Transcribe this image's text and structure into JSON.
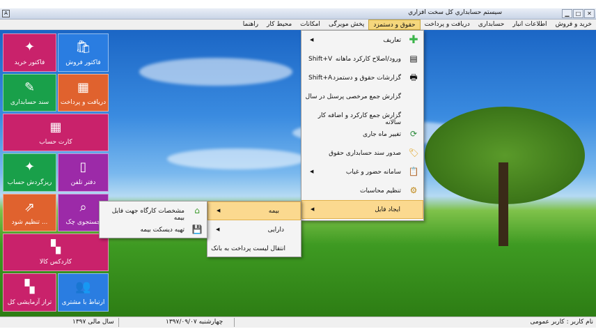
{
  "window": {
    "title": "سيستم حسابداري کل سخت افزاري",
    "icon": "app-icon"
  },
  "menubar": [
    "خرید و فروش",
    "اطلاعات انبار",
    "حسابداری",
    "دریافت و پرداخت",
    "حقوق و دستمزد",
    "پخش مویرگی",
    "امکانات",
    "محیط کار",
    "راهنما"
  ],
  "tiles": [
    {
      "label": "فاکتور فروش",
      "icon": "shopping-bag-icon",
      "color": "#2a7de1"
    },
    {
      "label": "فاکتور خرید",
      "icon": "puzzle-icon",
      "color": "#c9226b"
    },
    {
      "label": "دریافت و پرداخت",
      "icon": "calculator-icon",
      "color": "#e0622e"
    },
    {
      "label": "سند حسابداری",
      "icon": "document-edit-icon",
      "color": "#19a04a"
    },
    {
      "label": "کارت حساب",
      "icon": "grid-table-icon",
      "color": "#c9226b"
    },
    {
      "label": "دفتر تلفن",
      "icon": "phone-icon",
      "color": "#9c2aa8"
    },
    {
      "label": "ریزگردش حساب",
      "icon": "puzzle-icon",
      "color": "#19a04a"
    },
    {
      "label": "جستجوی چک",
      "icon": "search-document-icon",
      "color": "#9c2aa8"
    },
    {
      "label": "تنظیم شود ...",
      "icon": "external-link-icon",
      "color": "#e0622e"
    },
    {
      "label": "کاردکس کالا",
      "icon": "tiles-icon",
      "color": "#c9226b"
    },
    {
      "label": "ارتباط با مشتری",
      "icon": "users-icon",
      "color": "#2a7de1"
    },
    {
      "label": "تراز آزمایشی کل",
      "icon": "tiles-icon",
      "color": "#c9226b"
    }
  ],
  "main_menu": [
    {
      "label": "تعاریف",
      "icon": "plus-icon",
      "shortcut": "",
      "submenu": true
    },
    {
      "label": "ورود/اصلاح کارکرد ماهانه",
      "icon": "form-icon",
      "shortcut": "Shift+V",
      "submenu": false
    },
    {
      "label": "گزارشات حقوق و دستمزد",
      "icon": "printer-icon",
      "shortcut": "Shift+A",
      "submenu": false
    },
    {
      "label": "گزارش جمع مرخصی پرسنل در سال",
      "icon": "",
      "shortcut": "",
      "submenu": false
    },
    {
      "label": "گزارش جمع کارکرد و اضافه کار سالانه",
      "icon": "",
      "shortcut": "",
      "submenu": false
    },
    {
      "label": "تغییر ماه جاری",
      "icon": "refresh-icon",
      "shortcut": "",
      "submenu": false
    },
    {
      "label": "صدور سند حسابداری حقوق",
      "icon": "tag-icon",
      "shortcut": "",
      "submenu": false
    },
    {
      "label": "سامانه حضور و غیاب",
      "icon": "clipboard-icon",
      "shortcut": "",
      "submenu": true
    },
    {
      "label": "تنظیم محاسبات",
      "icon": "settings-doc-icon",
      "shortcut": "",
      "submenu": false
    },
    {
      "label": "ایجاد فایل",
      "icon": "",
      "shortcut": "",
      "submenu": true
    }
  ],
  "submenu_file": [
    {
      "label": "بیمه",
      "submenu": true
    },
    {
      "label": "دارایی",
      "submenu": true
    },
    {
      "label": "انتقال لیست پرداخت به بانک",
      "submenu": false
    }
  ],
  "submenu_insurance": [
    {
      "label": "مشخصات کارگاه جهت فایل بیمه",
      "icon": "home-icon"
    },
    {
      "label": "تهیه دیسکت بیمه",
      "icon": "floppy-disk-icon"
    }
  ],
  "statusbar": {
    "user": "نام کاربر : کاربر عمومی",
    "date": "چهارشنبه  ۱۳۹۷/۰۹/۰۷",
    "fiscal_year": "سال مالی ۱۳۹۷"
  }
}
